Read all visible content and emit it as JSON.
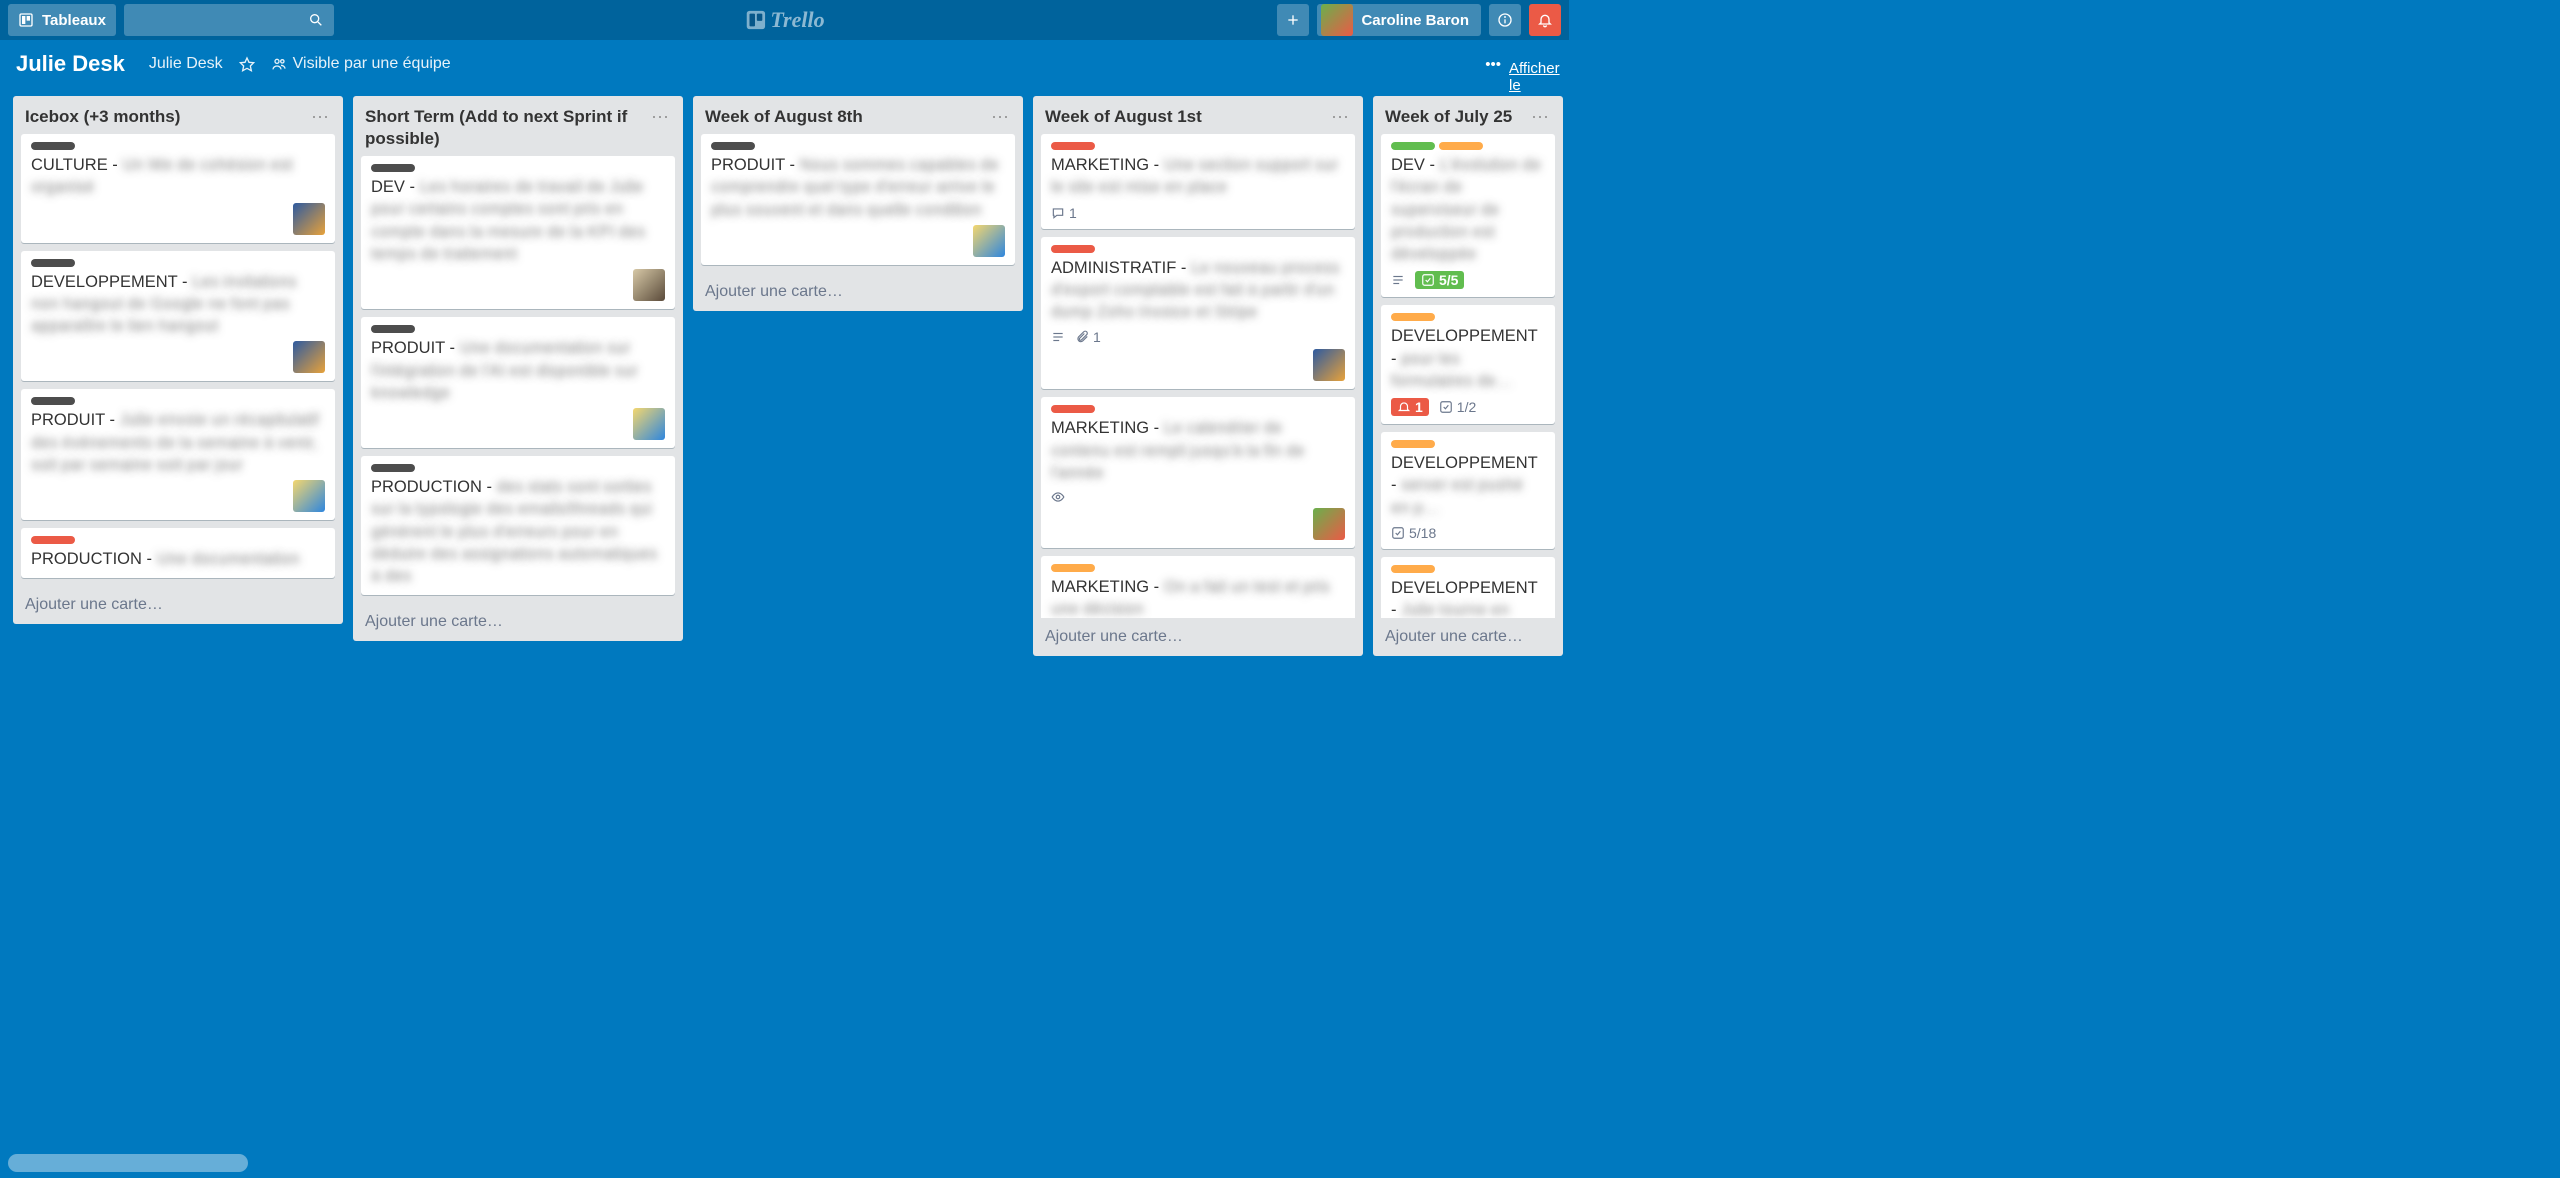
{
  "header": {
    "boards_label": "Tableaux",
    "user_name": "Caroline Baron",
    "logo_text": "Trello"
  },
  "board_bar": {
    "name": "Julie Desk",
    "org": "Julie Desk",
    "visibility": "Visible par une équipe",
    "show_menu": "Afficher le menu"
  },
  "add_card_label": "Ajouter une carte…",
  "lists": [
    {
      "title": "Icebox (+3 months)",
      "has_add": true,
      "cards": [
        {
          "labels": [
            "gray"
          ],
          "prefix": "CULTURE - ",
          "rest": "Un We de cohésion est organisé",
          "members": [
            "m1"
          ]
        },
        {
          "labels": [
            "gray"
          ],
          "prefix": "DEVELOPPEMENT - ",
          "rest": "Les invitations non hangout de Google ne font pas apparaître le lien hangout",
          "members": [
            "m1"
          ]
        },
        {
          "labels": [
            "gray"
          ],
          "prefix": "PRODUIT - ",
          "rest": "Julie envoie un récapitulatif des évènements de la semaine à venir, soit par semaine soit par jour",
          "members": [
            "m3"
          ]
        },
        {
          "labels": [
            "red"
          ],
          "prefix": "PRODUCTION - ",
          "rest": "Une documentation"
        }
      ]
    },
    {
      "title": "Short Term (Add to next Sprint if possible)",
      "has_add": true,
      "cards": [
        {
          "labels": [
            "gray"
          ],
          "prefix": "DEV - ",
          "rest": "Les horaires de travail de Julie pour certains comptes sont pris en compte dans la mesure de la KPI des temps de traitement",
          "members": [
            "m2"
          ]
        },
        {
          "labels": [
            "gray"
          ],
          "prefix": "PRODUIT - ",
          "rest": "Une documentation sur l'intégration de l'AI est disponible sur knowledge",
          "members": [
            "m3"
          ]
        },
        {
          "labels": [
            "gray"
          ],
          "prefix": "PRODUCTION - ",
          "rest": "des stats sont sorties sur la typologie des emails/threads qui génèrent le plus d'erreurs pour en déduire des assignations automatiques à des"
        }
      ]
    },
    {
      "title": "Week of August 8th",
      "has_add": true,
      "cards": [
        {
          "labels": [
            "gray"
          ],
          "prefix": "PRODUIT - ",
          "rest": "Nous sommes capables de comprendre quel type d'erreur arrive le plus souvent et dans quelle condition",
          "members": [
            "m3"
          ]
        }
      ]
    },
    {
      "title": "Week of August 1st",
      "has_add": true,
      "cards": [
        {
          "labels": [
            "red"
          ],
          "prefix": "MARKETING - ",
          "rest": "Une section support sur le site est mise en place",
          "badges": [
            {
              "type": "comments",
              "text": "1"
            }
          ]
        },
        {
          "labels": [
            "red"
          ],
          "prefix": "ADMINISTRATIF - ",
          "rest": "Le nouveau process d'export comptable est fait à partir d'un dump Zoho Invoice et Stripe",
          "badges": [
            {
              "type": "desc"
            },
            {
              "type": "attach",
              "text": "1"
            }
          ],
          "members": [
            "m1"
          ]
        },
        {
          "labels": [
            "red"
          ],
          "prefix": "MARKETING - ",
          "rest": "Le calendrier de contenu est rempli jusqu'à la fin de l'année",
          "badges": [
            {
              "type": "eye"
            }
          ],
          "members": [
            "m4"
          ]
        },
        {
          "labels": [
            "orange"
          ],
          "prefix": "MARKETING - ",
          "rest": "On a fait un test et pris une décision"
        }
      ]
    },
    {
      "title": "Week of July 25",
      "has_add": true,
      "truncated": true,
      "cards": [
        {
          "labels": [
            "green",
            "orange"
          ],
          "prefix": "DEV - ",
          "rest": "L'évolution de l'écran de superviseur de production est développée",
          "badges": [
            {
              "type": "desc"
            },
            {
              "type": "check-green",
              "text": "5/5"
            }
          ]
        },
        {
          "labels": [
            "orange"
          ],
          "prefix": "DEVELOPPEMENT - ",
          "rest": "pour les formulaires de…",
          "badges": [
            {
              "type": "notif-red",
              "text": "1"
            },
            {
              "type": "check",
              "text": "1/2"
            }
          ]
        },
        {
          "labels": [
            "orange"
          ],
          "prefix": "DEVELOPPEMENT - ",
          "rest": "server est pushé en p…",
          "badges": [
            {
              "type": "check",
              "text": "5/18"
            }
          ]
        },
        {
          "labels": [
            "orange"
          ],
          "prefix": "DEVELOPPEMENT - ",
          "rest": "Julie tourne en release"
        }
      ]
    }
  ]
}
